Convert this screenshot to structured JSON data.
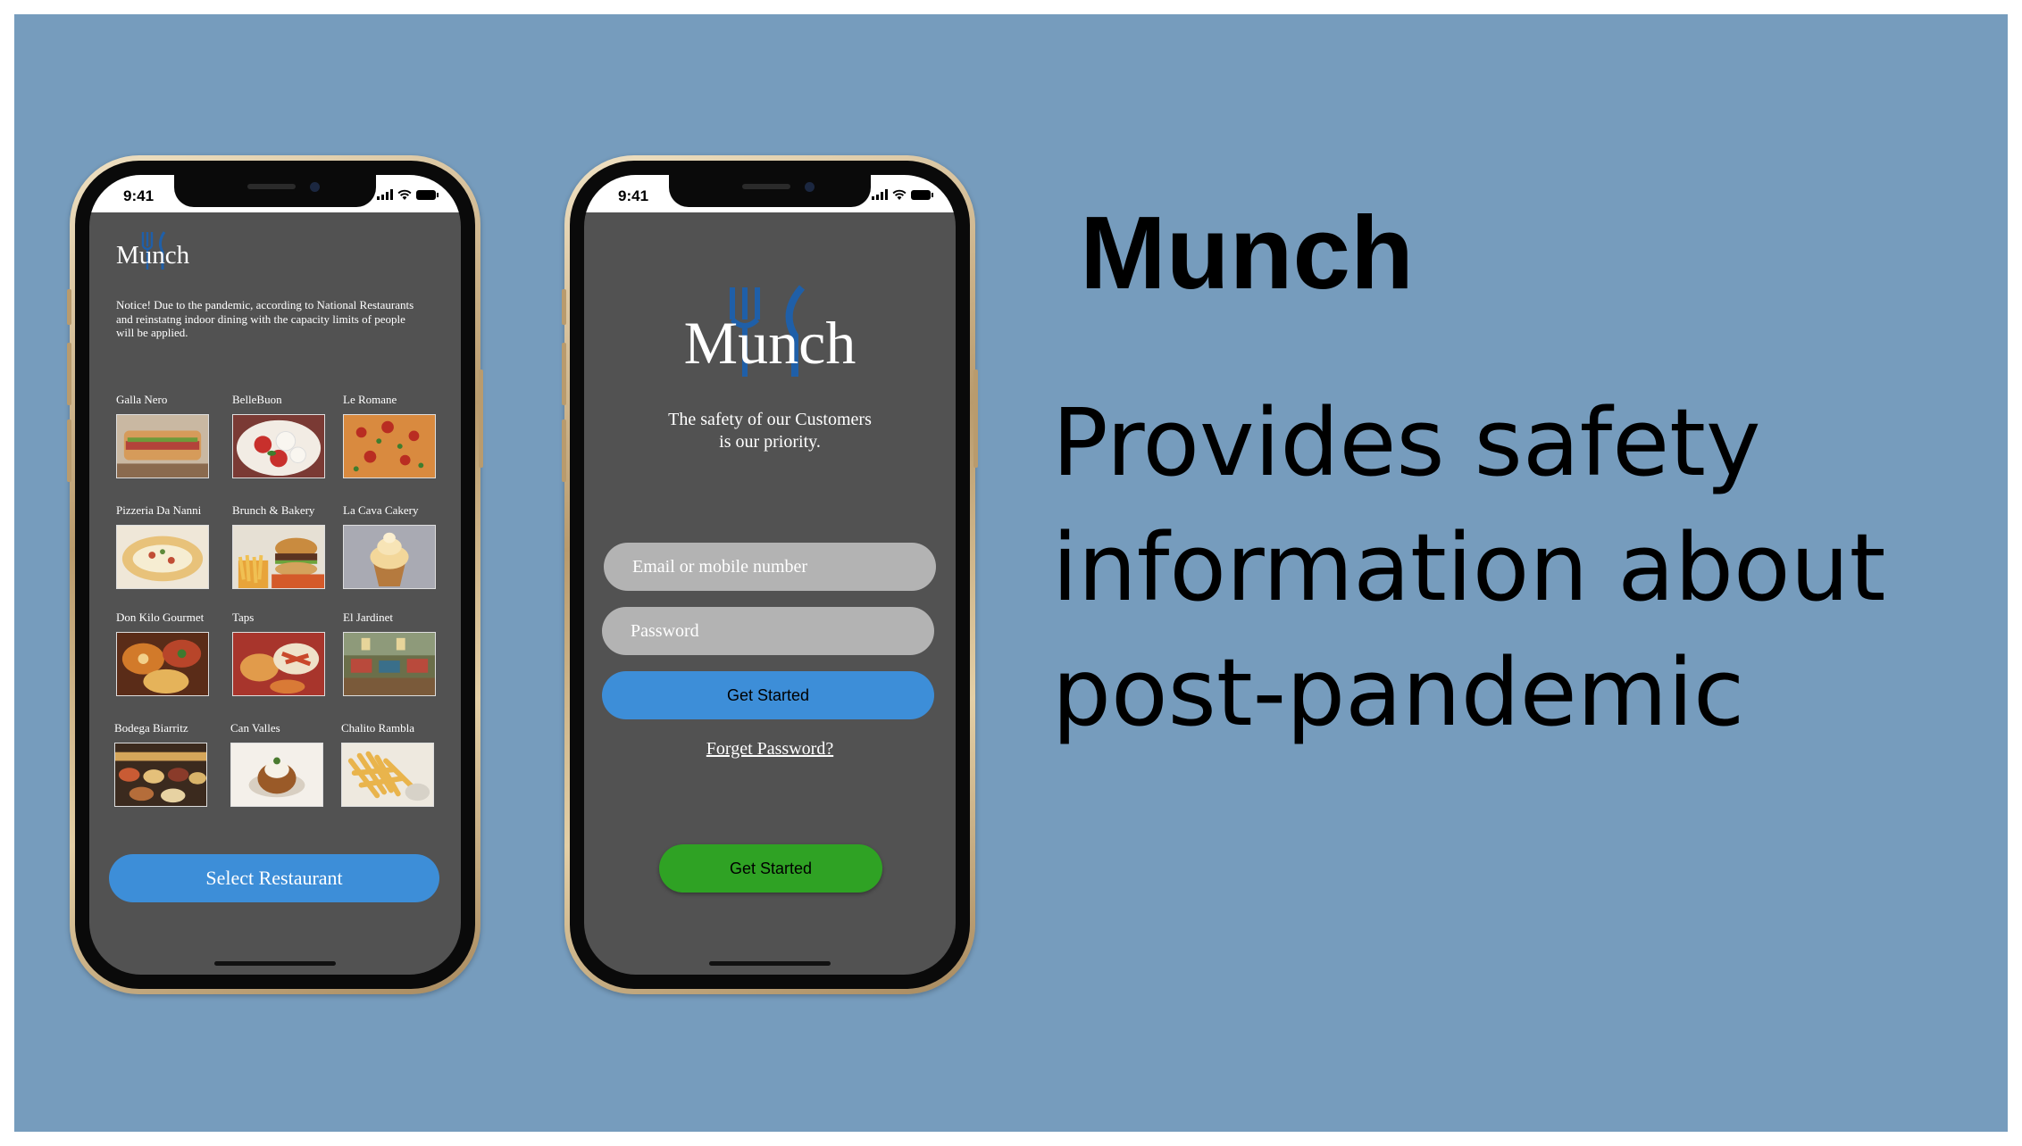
{
  "colors": {
    "background": "#769cbd",
    "screen": "#525252",
    "blue_button": "#3d8ed8",
    "green_button": "#2fa224",
    "input": "#b3b3b3",
    "logo_mark": "#1f5fa8"
  },
  "slide": {
    "title": "Munch",
    "description": "Provides safety information about post-pandemic"
  },
  "phone1": {
    "status_time": "9:41",
    "logo_text": "Munch",
    "notice": "Notice! Due to the pandemic, according to National Restaurants and reinstatng indoor dining with the capacity limits of people will be applied.",
    "restaurants": [
      {
        "name": "Galla Nero",
        "photo": "sandwich-photo"
      },
      {
        "name": "BelleBuon",
        "photo": "caprese-photo"
      },
      {
        "name": "Le Romane",
        "photo": "pizza-photo"
      },
      {
        "name": "Pizzeria Da Nanni",
        "photo": "flatbread-photo"
      },
      {
        "name": "Brunch & Bakery",
        "photo": "burger-fries-photo"
      },
      {
        "name": "La Cava Cakery",
        "photo": "cupcake-photo"
      },
      {
        "name": "Don Kilo Gourmet",
        "photo": "curry-photo"
      },
      {
        "name": "Taps",
        "photo": "tapas-photo"
      },
      {
        "name": "El Jardinet",
        "photo": "restaurant-interior-photo"
      },
      {
        "name": "Bodega Biarritz",
        "photo": "buffet-photo"
      },
      {
        "name": "Can Valles",
        "photo": "dessert-photo"
      },
      {
        "name": "Chalito Rambla",
        "photo": "fries-photo"
      }
    ],
    "select_button": "Select Restaurant"
  },
  "phone2": {
    "status_time": "9:41",
    "logo_text": "Munch",
    "tagline_line1": "The safety of our Customers",
    "tagline_line2": "is our priority.",
    "email_placeholder": "Email or mobile number",
    "password_placeholder": "Password",
    "get_started_blue": "Get Started",
    "forgot_password": "Forget Password?",
    "get_started_green": "Get Started"
  }
}
